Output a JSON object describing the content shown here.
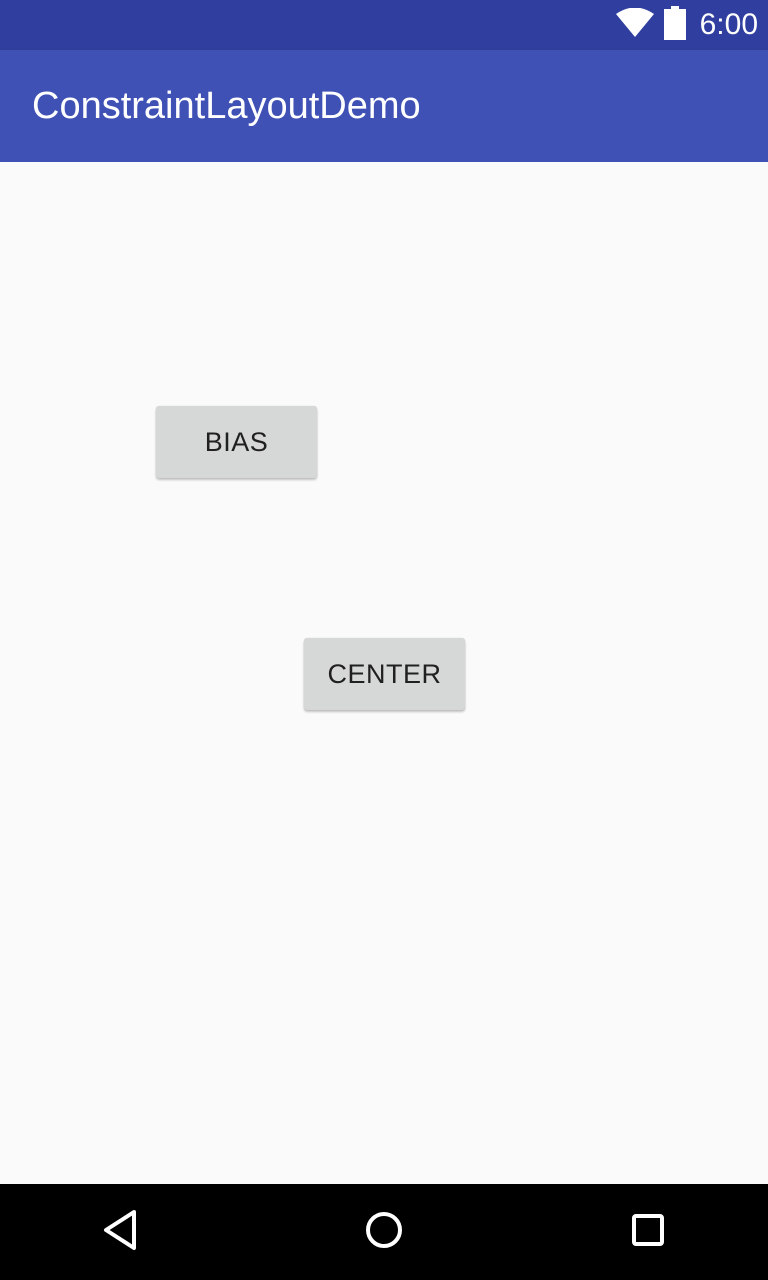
{
  "status_bar": {
    "time": "6:00",
    "icons": [
      "wifi-icon",
      "battery-icon"
    ],
    "background_color": "#303f9f"
  },
  "app_bar": {
    "title": "ConstraintLayoutDemo",
    "background_color": "#3f51b5"
  },
  "buttons": {
    "bias_label": "BIAS",
    "center_label": "CENTER",
    "background_color": "#d6d7d7"
  },
  "nav_bar": {
    "icons": [
      "back-icon",
      "home-icon",
      "recents-icon"
    ],
    "background_color": "#000000"
  }
}
